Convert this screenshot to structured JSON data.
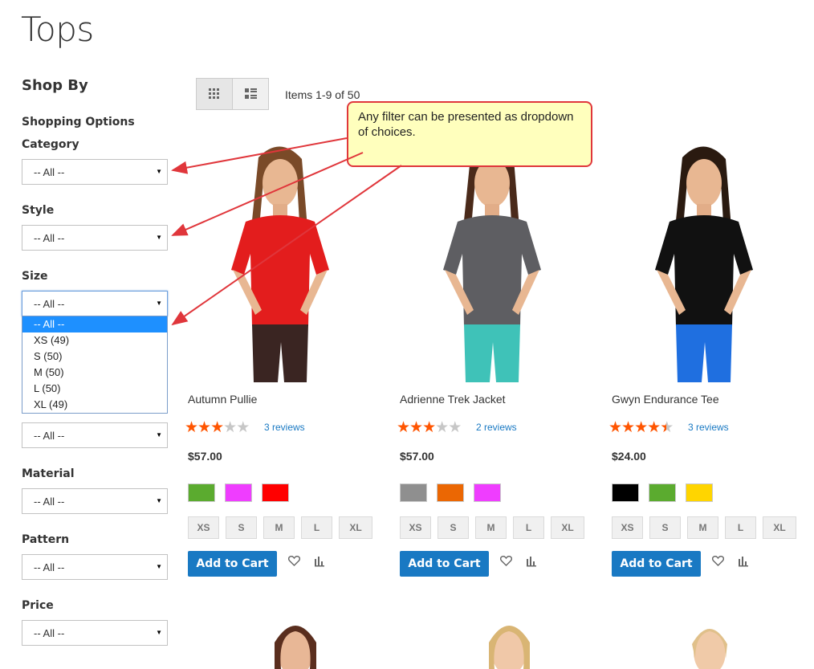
{
  "page": {
    "title": "Tops"
  },
  "sidebar": {
    "heading": "Shop By",
    "subheading": "Shopping Options",
    "filters": [
      {
        "label": "Category",
        "value": "-- All --"
      },
      {
        "label": "Style",
        "value": "-- All --"
      },
      {
        "label": "Size",
        "value": "-- All --"
      },
      {
        "label": "",
        "value": "-- All --"
      },
      {
        "label": "Material",
        "value": "-- All --"
      },
      {
        "label": "Pattern",
        "value": "-- All --"
      },
      {
        "label": "Price",
        "value": "-- All --"
      }
    ],
    "size_options": [
      "-- All --",
      "XS (49)",
      "S (50)",
      "M (50)",
      "L (50)",
      "XL (49)"
    ],
    "size_selected": "-- All --"
  },
  "toolbar": {
    "items_count": "Items 1-9 of 50",
    "grid_icon": "grid-view-icon",
    "list_icon": "list-view-icon"
  },
  "callout": {
    "text": "Any filter can be presented as dropdown of choices."
  },
  "products": [
    {
      "name": "Autumn Pullie",
      "rating": 3,
      "max_rating": 5,
      "reviews": "3 reviews",
      "price": "$57.00",
      "swatches": [
        "#5bab2f",
        "#ef3dff",
        "#ff0000"
      ],
      "sizes": [
        "XS",
        "S",
        "M",
        "L",
        "XL"
      ],
      "add_label": "Add to Cart",
      "shirt_color": "#e31d1d",
      "pants_color": "#3a2522",
      "hair_color": "#7a4a28"
    },
    {
      "name": "Adrienne Trek Jacket",
      "rating": 3,
      "max_rating": 5,
      "reviews": "2 reviews",
      "price": "$57.00",
      "swatches": [
        "#8f8f8f",
        "#eb6703",
        "#ef3dff"
      ],
      "sizes": [
        "XS",
        "S",
        "M",
        "L",
        "XL"
      ],
      "add_label": "Add to Cart",
      "shirt_color": "#5e5e62",
      "pants_color": "#3fc2b8",
      "hair_color": "#4a2a1a"
    },
    {
      "name": "Gwyn Endurance Tee",
      "rating": 4.5,
      "max_rating": 5,
      "reviews": "3 reviews",
      "price": "$24.00",
      "swatches": [
        "#000000",
        "#5bab2f",
        "#ffd500"
      ],
      "sizes": [
        "XS",
        "S",
        "M",
        "L",
        "XL"
      ],
      "add_label": "Add to Cart",
      "shirt_color": "#111111",
      "pants_color": "#1f6fe0",
      "hair_color": "#2a1a10"
    }
  ],
  "colors": {
    "accent": "#1979c3",
    "star": "#ff5501",
    "callout_border": "#e0363b",
    "callout_bg": "#ffffbd",
    "arrow": "#e0363b"
  }
}
